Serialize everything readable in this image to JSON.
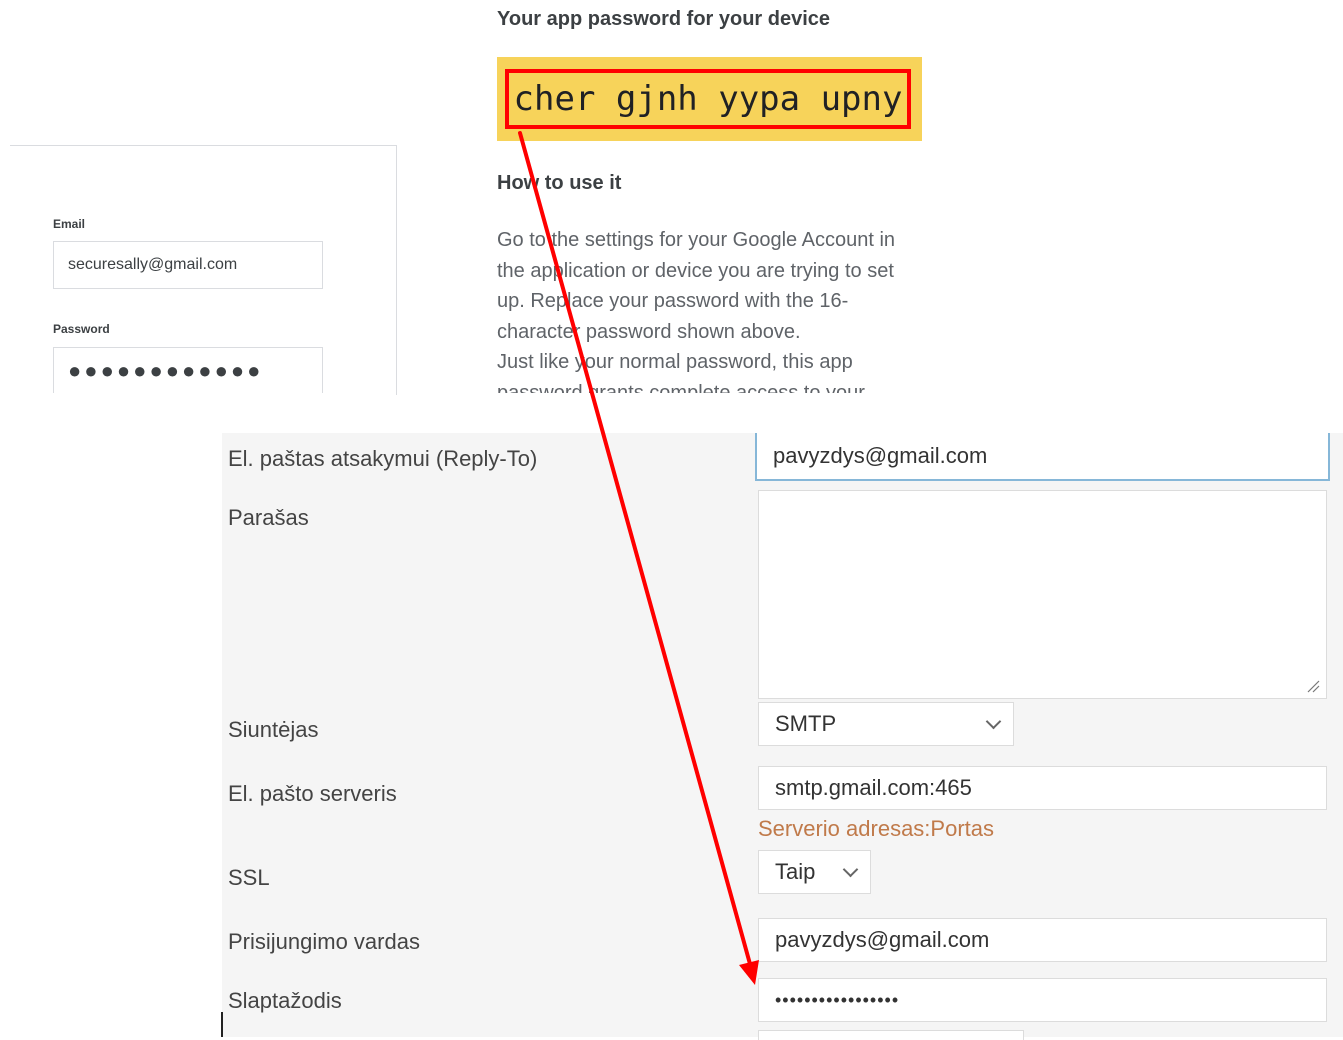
{
  "app_password": {
    "title": "Your app password for your device",
    "code": "cher gjnh yypa upny",
    "howto_title": "How to use it",
    "body_lines": [
      "Go to the settings for your Google Account in",
      "the application or device you are trying to set",
      "up. Replace your password with the 16-",
      "character password shown above.",
      "Just like your normal password, this app",
      "password grants complete access to your"
    ]
  },
  "login": {
    "email_label": "Email",
    "email_value": "securesally@gmail.com",
    "password_label": "Password",
    "password_value": "●●●●●●●●●●●●"
  },
  "form": {
    "reply_to_label": "El. paštas atsakymui (Reply-To)",
    "reply_to_value": "pavyzdys@gmail.com",
    "signature_label": "Parašas",
    "signature_value": "",
    "sender_label": "Siuntėjas",
    "sender_value": "SMTP",
    "server_label": "El. pašto serveris",
    "server_value": "smtp.gmail.com:465",
    "server_hint": "Serverio adresas:Portas",
    "ssl_label": "SSL",
    "ssl_value": "Taip",
    "username_label": "Prisijungimo vardas",
    "username_value": "pavyzdys@gmail.com",
    "password_label": "Slaptažodis",
    "password_value": "•••••••••••••••••"
  },
  "colors": {
    "highlight": "#f7d35a",
    "annotation_red": "#ff0000",
    "hint": "#c07a4a"
  }
}
